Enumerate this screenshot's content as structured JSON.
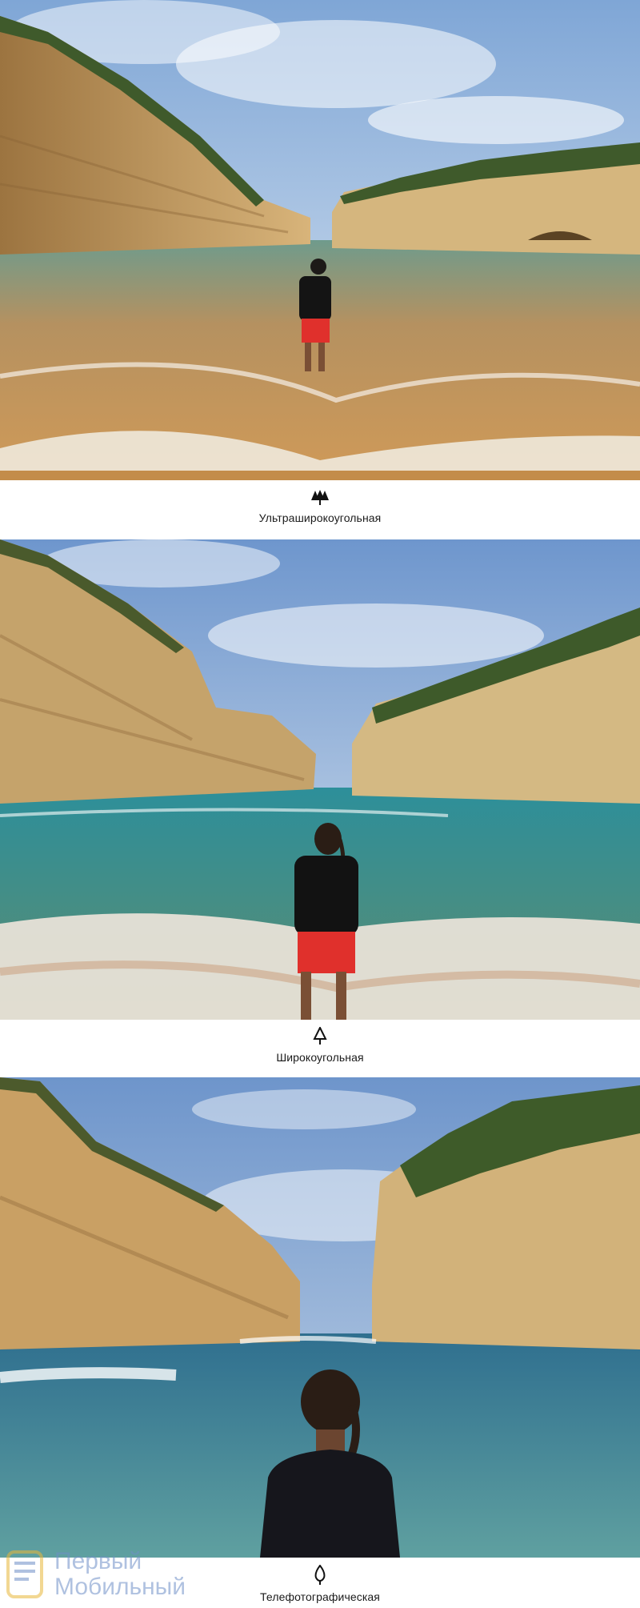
{
  "photos": [
    {
      "caption": "Ультраширокоугольная",
      "lens_icon": "triple-tree-icon"
    },
    {
      "caption": "Широкоугольная",
      "lens_icon": "single-tree-icon"
    },
    {
      "caption": "Телефотографическая",
      "lens_icon": "leaf-icon"
    }
  ],
  "watermark": {
    "line1": "Первый",
    "line2": "Мобильный"
  },
  "colors": {
    "sky": "#9fbfe2",
    "cliff": "#c9a66b",
    "sea": "#4f8f8c",
    "sand": "#c99a5a",
    "shorts": "#e0302c"
  }
}
